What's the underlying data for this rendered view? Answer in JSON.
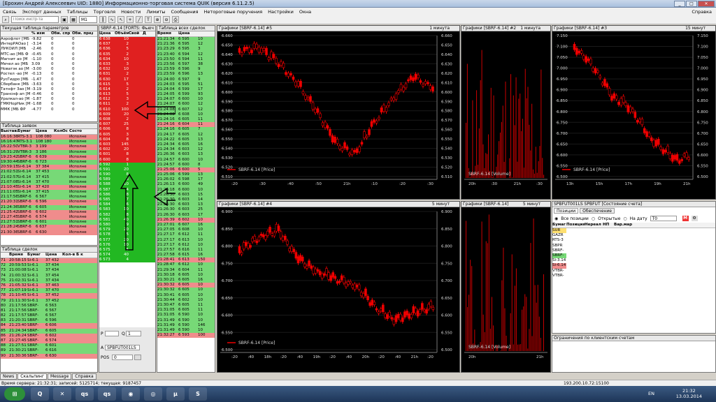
{
  "window": {
    "title": "[Ерохин Андрей Алексеевич UID: 1880] Информационно-торговая система QUIK (версия 6.11.2.5)",
    "help": "Справка"
  },
  "menu": [
    "Связь",
    "Экспорт данных",
    "Таблицы",
    "Торговля",
    "Новости",
    "Лимиты",
    "Сообщения",
    "Нетороговые поручения",
    "Настройки",
    "Окна"
  ],
  "toolbar": {
    "search_placeholder": "Поиск инстр-та",
    "interval": "M1"
  },
  "params": {
    "title": "Текущая таблица параметров",
    "headers": [
      "",
      "% изм",
      "Оби. спр",
      "Оби. пред"
    ],
    "rows": [
      [
        "Аэрофлот [МБ",
        "-9.82",
        "0",
        "0"
      ],
      [
        "ИнтерРАОао [",
        "-3.14",
        "0",
        "0"
      ],
      [
        "ЛУКОЙЛ [МБ",
        "-2.46",
        "0",
        "0"
      ],
      [
        "МТС-ао [МБ Ф",
        "-0.45",
        "0",
        "0"
      ],
      [
        "Магнит ао [М",
        "-1.10",
        "0",
        "0"
      ],
      [
        "Мечел ао [МБ",
        "3.09",
        "0",
        "0"
      ],
      [
        "Новатэк ао [М",
        "-3.00",
        "0",
        "0"
      ],
      [
        "Ростел -ао [М",
        "-0.13",
        "0",
        "0"
      ],
      [
        "РусГидро [МБ",
        "-1.47",
        "0",
        "0"
      ],
      [
        "Сбербанк [МБ",
        "-3.63",
        "0",
        "0"
      ],
      [
        "Татнфт 3ао [М",
        "-3.19",
        "0",
        "0"
      ],
      [
        "Транснф ап [М",
        "-0.46",
        "0",
        "0"
      ],
      [
        "Уралкал-ао [М",
        "-1.87",
        "0",
        "0"
      ],
      [
        "ГМКНорНик [М",
        "-1.68",
        "0",
        "0"
      ],
      [
        "ММК [МБ ФР",
        "-4.77",
        "0",
        "0"
      ]
    ]
  },
  "orders": {
    "title": "Таблица заявок",
    "headers": [
      "Выставл",
      "Бумаг",
      "Цена",
      "Кол",
      "Ос",
      "Состо"
    ],
    "rows": [
      [
        "16:16:36",
        "RTS-3.1",
        "108 080",
        "",
        "",
        "Исполне",
        "red"
      ],
      [
        "16:16:47",
        "RTS-3.1",
        "108 180",
        "",
        "",
        "Исполне",
        "green"
      ],
      [
        "16:22:50",
        "VTBR-3",
        "3 199",
        "",
        "",
        "Исполне",
        "red"
      ],
      [
        "16:31:29",
        "VTBR-3",
        "3 186",
        "",
        "",
        "Исполне",
        "green"
      ],
      [
        "19:23:42",
        "SBRF-6",
        "6 639",
        "",
        "",
        "Исполне",
        "red"
      ],
      [
        "19:30:44",
        "SBRF-6",
        "6 723",
        "",
        "",
        "Исполне",
        "green"
      ],
      [
        "20:59:15",
        "Si-6.14",
        "37 384",
        "",
        "",
        "Исполне",
        "red"
      ],
      [
        "21:02:51",
        "Si-6.14",
        "37 453",
        "",
        "",
        "Исполне",
        "green"
      ],
      [
        "21:02:57",
        "Si-6.14",
        "37 415",
        "",
        "",
        "Исполне",
        "green"
      ],
      [
        "21:07:08",
        "Si-6.14",
        "37 470",
        "",
        "",
        "Исполне",
        "green"
      ],
      [
        "21:10:45",
        "Si-6.14",
        "37 420",
        "",
        "",
        "Исполне",
        "red"
      ],
      [
        "21:11:05",
        "Si-6.14",
        "37 415",
        "",
        "",
        "Исполне",
        "green"
      ],
      [
        "21:17:56",
        "SBRF-6",
        "6 567",
        "",
        "",
        "Исполне",
        "green"
      ],
      [
        "21:20:31",
        "SBRF-6",
        "6 596",
        "",
        "",
        "Исполне",
        "red"
      ],
      [
        "21:24:36",
        "SBRF-6",
        "6 605",
        "",
        "",
        "Исполне",
        "green"
      ],
      [
        "21:25:42",
        "SBRF-6",
        "6 602",
        "",
        "",
        "Исполне",
        "red"
      ],
      [
        "21:27:45",
        "SBRF-6",
        "6 574",
        "",
        "",
        "Исполне",
        "red"
      ],
      [
        "21:27:51",
        "SBRF-6",
        "6 601",
        "",
        "",
        "Исполне",
        "green"
      ],
      [
        "21:28:24",
        "SBRF-6",
        "6 637",
        "",
        "",
        "Исполне",
        "red"
      ],
      [
        "21:30:36",
        "SBRF-6",
        "6 630",
        "",
        "",
        "Исполне",
        "red"
      ]
    ]
  },
  "trades": {
    "title": "Таблица сделок",
    "headers": [
      "",
      "Время",
      "Бумаг",
      "Цена",
      "Кол-в",
      "Б к"
    ],
    "rows": [
      [
        "71",
        "20:58:15",
        "Si-6.1",
        "37 432",
        "",
        "",
        "red"
      ],
      [
        "72",
        "20:59:53",
        "Si-6.1",
        "37 434",
        "",
        "",
        "green"
      ],
      [
        "73",
        "21:00:08",
        "Si-6.1",
        "37 434",
        "",
        "",
        "green"
      ],
      [
        "74",
        "21:00:32",
        "Si-6.1",
        "37 454",
        "",
        "",
        "green"
      ],
      [
        "75",
        "21:02:31",
        "Si-6.1",
        "37 434",
        "",
        "",
        "green"
      ],
      [
        "76",
        "21:05:32",
        "Si-6.1",
        "37 463",
        "",
        "",
        "red"
      ],
      [
        "77",
        "21:07:19",
        "Si-6.1",
        "37 470",
        "",
        "",
        "green"
      ],
      [
        "78",
        "21:10:45",
        "Si-6.1",
        "37 452",
        "",
        "",
        "red"
      ],
      [
        "79",
        "21:11:30",
        "Si-6.1",
        "37 452",
        "",
        "",
        "green"
      ],
      [
        "80",
        "21:17:56",
        "SBRF-",
        "6 563",
        "",
        "",
        "green"
      ],
      [
        "81",
        "21:17:56",
        "SBRF-",
        "6 567",
        "",
        "",
        "green"
      ],
      [
        "82",
        "21:17:57",
        "SBRF-",
        "6 567",
        "",
        "",
        "green"
      ],
      [
        "83",
        "21:20:31",
        "SBRF-",
        "6 596",
        "",
        "",
        "green"
      ],
      [
        "84",
        "21:23:40",
        "SBRF-",
        "6 606",
        "",
        "",
        "red"
      ],
      [
        "85",
        "21:24:34",
        "SBRF-",
        "6 605",
        "",
        "",
        "green"
      ],
      [
        "86",
        "21:26:24",
        "SBRF-",
        "6 602",
        "",
        "",
        "red"
      ],
      [
        "87",
        "21:27:45",
        "SBRF-",
        "6 574",
        "",
        "",
        "red"
      ],
      [
        "88",
        "21:27:51",
        "SBRF-",
        "6 601",
        "",
        "",
        "green"
      ],
      [
        "89",
        "21:30:21",
        "SBRF-",
        "6 616",
        "",
        "",
        "green"
      ],
      [
        "90",
        "21:30:36",
        "SBRF-",
        "6 630",
        "",
        "",
        "red"
      ]
    ]
  },
  "scalper": {
    "title": "SBRF-6.14 [FORTS: Фьюч",
    "headers": [
      "Цена",
      "Объём",
      "Свой",
      "Д"
    ],
    "ask_rows": [
      [
        "6 638",
        "10"
      ],
      [
        "6 637",
        "2"
      ],
      [
        "6 636",
        "5"
      ],
      [
        "6 635",
        "2"
      ],
      [
        "6 634",
        "10"
      ],
      [
        "6 633",
        "3"
      ],
      [
        "6 632",
        "10"
      ],
      [
        "6 631",
        "2"
      ],
      [
        "6 630",
        "17"
      ],
      [
        "6 615",
        "5"
      ],
      [
        "6 614",
        "2"
      ],
      [
        "6 613",
        "5"
      ],
      [
        "6 612",
        "3"
      ],
      [
        "6 611",
        "2"
      ],
      [
        "6 610",
        "100"
      ],
      [
        "6 609",
        "20"
      ],
      [
        "6 608",
        "2"
      ],
      [
        "6 607",
        "25"
      ],
      [
        "6 606",
        "8"
      ],
      [
        "6 605",
        "3"
      ],
      [
        "6 604",
        "8"
      ],
      [
        "6 603",
        "145"
      ],
      [
        "6 602",
        "20"
      ],
      [
        "6 601",
        "8"
      ],
      [
        "6 600",
        "8"
      ]
    ],
    "bid_rows": [
      [
        "6 592",
        "1"
      ],
      [
        "6 591",
        "20"
      ],
      [
        "6 590",
        "8"
      ],
      [
        "6 589",
        "3"
      ],
      [
        "6 588",
        "10"
      ],
      [
        "6 587",
        "4"
      ],
      [
        "6 586",
        "8"
      ],
      [
        "6 585",
        "7"
      ],
      [
        "6 584",
        "6"
      ],
      [
        "6 583",
        "10"
      ],
      [
        "6 582",
        "8"
      ],
      [
        "6 581",
        "40"
      ],
      [
        "6 580",
        "9"
      ],
      [
        "6 579",
        "20"
      ],
      [
        "6 578",
        "5"
      ],
      [
        "6 577",
        "20"
      ],
      [
        "6 576",
        "10"
      ],
      [
        "6 575",
        "5"
      ],
      [
        "6 574",
        "40"
      ],
      [
        "6 573",
        "4"
      ]
    ],
    "p_label": "P",
    "q_label": "Q",
    "q_value": "1",
    "pos_label": "POS",
    "pos_value": "0",
    "account": "SPBFUT001LS",
    "a_label": "A"
  },
  "ticks": {
    "title": "Таблица всех сделок",
    "headers": [
      "Время",
      "Цена",
      ""
    ],
    "rows": [
      [
        "21:21:34",
        "6 595",
        "10",
        "green"
      ],
      [
        "21:21:36",
        "6 595",
        "12",
        "green"
      ],
      [
        "21:23:29",
        "6 595",
        "3",
        "green"
      ],
      [
        "21:23:40",
        "6 594",
        "12",
        "green"
      ],
      [
        "21:23:50",
        "6 594",
        "11",
        "green"
      ],
      [
        "21:23:56",
        "6 597",
        "38",
        "green"
      ],
      [
        "21:23:59",
        "6 596",
        "9",
        "green"
      ],
      [
        "21:23:59",
        "6 596",
        "13",
        "green"
      ],
      [
        "21:24:00",
        "6 597",
        "9",
        "green"
      ],
      [
        "21:24:03",
        "6 595",
        "51",
        "green"
      ],
      [
        "21:24:04",
        "6 599",
        "17",
        "green"
      ],
      [
        "21:24:05",
        "6 599",
        "93",
        "green"
      ],
      [
        "21:24:07",
        "6 600",
        "10",
        "green"
      ],
      [
        "21:24:07",
        "6 600",
        "12",
        "green"
      ],
      [
        "21:24:08",
        "6 607",
        "12",
        "green"
      ],
      [
        "21:24:08",
        "6 608",
        "10",
        "green"
      ],
      [
        "21:24:16",
        "6 605",
        "11",
        "green"
      ],
      [
        "21:24:16",
        "6 604",
        "11",
        "red"
      ],
      [
        "21:24:16",
        "6 605",
        "7",
        "green"
      ],
      [
        "21:24:17",
        "6 605",
        "12",
        "green"
      ],
      [
        "21:24:22",
        "6 605",
        "13",
        "green"
      ],
      [
        "21:24:34",
        "6 605",
        "16",
        "green"
      ],
      [
        "21:24:34",
        "6 603",
        "12",
        "green"
      ],
      [
        "21:26:36",
        "6 603",
        "13",
        "green"
      ],
      [
        "21:24:57",
        "6 600",
        "10",
        "green"
      ],
      [
        "21:24:57",
        "6 600",
        "8",
        "green"
      ],
      [
        "21:25:06",
        "6 600",
        "5",
        "red"
      ],
      [
        "21:25:06",
        "6 599",
        "13",
        "green"
      ],
      [
        "21:26:02",
        "6 598",
        "17",
        "green"
      ],
      [
        "21:26:13",
        "6 600",
        "49",
        "green"
      ],
      [
        "21:26:18",
        "6 600",
        "10",
        "green"
      ],
      [
        "21:26:30",
        "6 603",
        "15",
        "green"
      ],
      [
        "21:26:30",
        "6 603",
        "14",
        "green"
      ],
      [
        "21:26:30",
        "6 603",
        "13",
        "green"
      ],
      [
        "21:26:30",
        "6 603",
        "25",
        "green"
      ],
      [
        "21:26:30",
        "6 603",
        "17",
        "green"
      ],
      [
        "21:26:39",
        "6 602",
        "10",
        "red"
      ],
      [
        "21:27:01",
        "6 607",
        "16",
        "green"
      ],
      [
        "21:27:05",
        "6 608",
        "10",
        "green"
      ],
      [
        "21:27:17",
        "6 612",
        "11",
        "green"
      ],
      [
        "21:27:17",
        "6 613",
        "10",
        "green"
      ],
      [
        "21:27:17",
        "6 612",
        "10",
        "green"
      ],
      [
        "21:27:57",
        "6 616",
        "11",
        "green"
      ],
      [
        "21:27:58",
        "6 615",
        "16",
        "green"
      ],
      [
        "21:28:41",
        "6 613",
        "150",
        "red"
      ],
      [
        "21:28:47",
        "6 612",
        "10",
        "green"
      ],
      [
        "21:29:34",
        "6 604",
        "11",
        "green"
      ],
      [
        "21:30:18",
        "6 605",
        "10",
        "green"
      ],
      [
        "21:30:21",
        "6 605",
        "16",
        "green"
      ],
      [
        "21:30:32",
        "6 605",
        "10",
        "red"
      ],
      [
        "21:30:32",
        "6 605",
        "10",
        "green"
      ],
      [
        "21:30:41",
        "6 605",
        "10",
        "green"
      ],
      [
        "21:30:44",
        "6 602",
        "10",
        "green"
      ],
      [
        "21:30:47",
        "6 605",
        "11",
        "green"
      ],
      [
        "21:31:05",
        "6 605",
        "11",
        "green"
      ],
      [
        "21:31:05",
        "6 590",
        "10",
        "green"
      ],
      [
        "21:31:49",
        "6 590",
        "10",
        "green"
      ],
      [
        "21:31:49",
        "6 590",
        "146",
        "green"
      ],
      [
        "21:31:49",
        "6 590",
        "10",
        "green"
      ],
      [
        "21:32:27",
        "6 593",
        "100",
        "red"
      ]
    ]
  },
  "charts": {
    "c5": {
      "title": "Графики [SBRF-6.14] #5",
      "period": "1 минута",
      "legend": "SBRF-6.14 [Price]",
      "y_ticks": [
        "6.660",
        "6.650",
        "6.640",
        "6.630",
        "6.620",
        "6.610",
        "6.600",
        "6.590",
        "6.580",
        "6.570",
        "6.560",
        "6.550",
        "6.540",
        "6.530",
        "6.520",
        "6.510"
      ],
      "x_ticks": [
        ":20",
        ":30",
        ":40",
        ":50",
        "21h",
        ":10",
        ":20",
        ":30"
      ]
    },
    "c2": {
      "title": "Графики [SBRF-6.14] #2",
      "period": "1 минута",
      "legend": "SBRF-6.14 [Volume]",
      "x_ticks": [
        "20h",
        ":30",
        "21h",
        ":30"
      ]
    },
    "c3": {
      "title": "Графики [SBRF-6.14] #3",
      "period": "15 минут",
      "legend": "SBRF-6.14 [Price]",
      "y_ticks": [
        "7.150",
        "7.100",
        "7.050",
        "7.000",
        "6.950",
        "6.900",
        "6.850",
        "6.800",
        "6.750",
        "6.700",
        "6.650",
        "6.600",
        "6.550",
        "6.500"
      ],
      "x_ticks": [
        "13h",
        "15h",
        "17h",
        "19h",
        "21h"
      ]
    },
    "c4": {
      "title": "Графики [SBRF-6.14] #4",
      "period": "5 минут",
      "legend": "SBRF-6.14 [Price]",
      "y_ticks": [
        "6.900",
        "6.850",
        "6.800",
        "6.750",
        "6.700",
        "6.650",
        "6.600",
        "6.550",
        "6.500"
      ],
      "x_ticks": [
        ":20",
        ":40",
        "18h",
        ":20",
        ":40",
        "19h",
        ":20",
        ":40",
        "20h",
        ":20",
        ":40",
        "21h",
        ":20"
      ]
    },
    "c6": {
      "title": "Графики [SBRF-6.14]",
      "period": "5 минут",
      "legend": "SBRF-6.14 [Volume]",
      "x_ticks": [
        "20h",
        "21h"
      ]
    }
  },
  "positions": {
    "title": "SPBFUT001LS SPBFUT [Состояние счета]",
    "tabs": [
      "Позиции",
      "Обеспечение"
    ],
    "filter_all": "Все позиции",
    "filter_open": "Открытые",
    "filter_date": "На дату",
    "date_value": "T0",
    "headers": [
      "Бумаг",
      "Позиция",
      "Нереал",
      "НП",
      "Вар.мар"
    ],
    "rows": [
      [
        "SUR",
        "yellow"
      ],
      [
        "GAZR",
        ""
      ],
      [
        "RTS-3",
        ""
      ],
      [
        "SBPR",
        ""
      ],
      [
        "SBRF-",
        ""
      ],
      [
        "SBRF-",
        "green"
      ],
      [
        "Si-3.14",
        ""
      ],
      [
        "Si-6.14",
        "red"
      ],
      [
        "VTBR-",
        ""
      ],
      [
        "VTBR-",
        ""
      ]
    ]
  },
  "client_limits": {
    "title": "Ограничения по клиентским счетам"
  },
  "bottom_tabs": [
    "News",
    "Скальпинг",
    "Message",
    "Справка"
  ],
  "status": {
    "text": "Время сервера: 21:32:31; записей: 5125714; текущая: 9187457",
    "connection": "193.200.10.72:15100"
  },
  "taskbar": {
    "lang": "EN",
    "time": "21:32",
    "date": "13.03.2014"
  }
}
